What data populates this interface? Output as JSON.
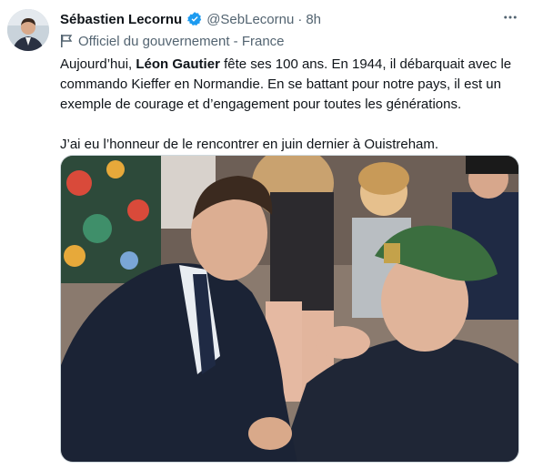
{
  "tweet": {
    "author_name": "Sébastien Lecornu",
    "author_handle": "@SebLecornu",
    "separator": "·",
    "timestamp": "8h",
    "official_label": "Officiel du gouvernement - France",
    "paragraph1": {
      "part1": "Aujourd’hui, ",
      "bold": "Léon Gautier",
      "part2": " fête ses 100 ans. En 1944, il débarquait avec le commando Kieffer en Normandie. En se battant pour notre pays, il est un exemple de courage et d’engagement pour toutes les générations."
    },
    "paragraph2": "J’ai eu l’honneur de le rencontrer en juin dernier à Ouistreham."
  },
  "icons": {
    "verified": "verified-badge-icon",
    "more": "more-horizontal-icon",
    "official": "flag-icon"
  },
  "colors": {
    "text": "#0f1419",
    "secondary": "#536471",
    "verified": "#1d9bf0",
    "beret": "#3b6e3f"
  }
}
